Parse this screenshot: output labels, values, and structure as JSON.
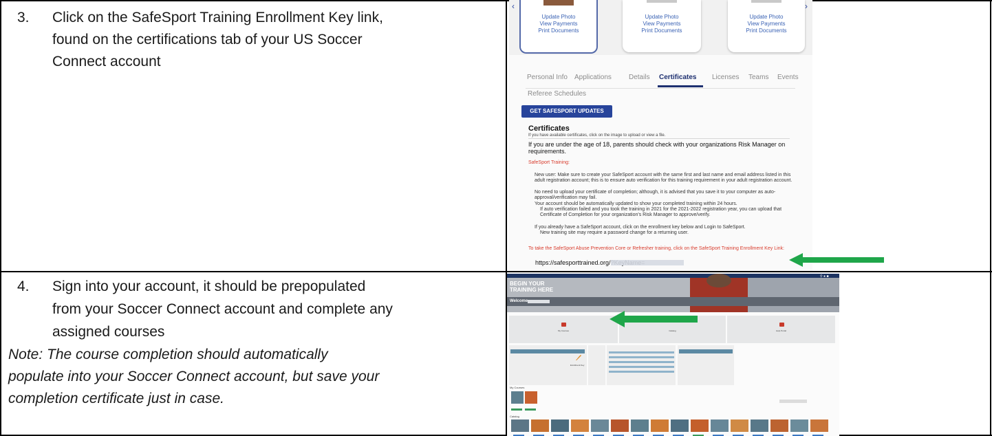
{
  "step3": {
    "number": "3.",
    "lines": [
      "Click on the SafeSport Training Enrollment Key link,",
      "found on the certifications tab of your US Soccer",
      "Connect account"
    ]
  },
  "step4": {
    "number": "4.",
    "lines": [
      "Sign into your account, it should be prepopulated",
      "from your Soccer Connect account and complete any",
      "assigned courses"
    ],
    "note_lines": [
      "Note: The course completion should automatically",
      "populate into your Soccer Connect account, but save your",
      "completion certificate just in case."
    ]
  },
  "shot1": {
    "cards": [
      {
        "line1": "Update Photo",
        "line2": "View Payments",
        "line3": "Print Documents"
      },
      {
        "line1": "Update Photo",
        "line2": "View Payments",
        "line3": "Print Documents"
      },
      {
        "line1": "Update Photo",
        "line2": "View Payments",
        "line3": "Print Documents"
      }
    ],
    "tabs": [
      "Personal Info",
      "Applications",
      "Details",
      "Certificates",
      "Licenses",
      "Teams",
      "Events"
    ],
    "active_tab": "Certificates",
    "tab_row2": "Referee Schedules",
    "button": "GET SAFESPORT UPDATES",
    "cert_title": "Certificates",
    "cert_subtitle": "If you have available certificates, click on the image to upload or view a file.",
    "age_notice": "If you are under the age of 18, parents should check with your organizations Risk Manager on requirements.",
    "safesport_heading": "SafeSport Training:",
    "paragraphs": [
      "New user:  Make sure to create your SafeSport account with the same first and last name and email address listed in this adult registration account; this is to ensure auto verification for this training requirement in your adult registration account.",
      "No need to upload your certificate of completion; although, it is advised that you save it to your computer as auto-approval/verification may fail.",
      "Your account should be automatically updated to show your completed training within 24 hours.",
      "If auto verification failed and you took the training in 2021 for the 2021-2022 registration year, you can upload that Certificate of Completion for your organization's Risk Manager to approve/verify.",
      "If you already have a SafeSport account, click on the enrollment key below and Login to SafeSport.",
      "New training site may require a password change for a returning user."
    ],
    "enroll_instruction": "To take the SafeSport Abuse Prevention Core or Refresher training, click on the SafeSport Training Enrollment Key Link:",
    "enroll_link": "https://safesporttrained.org/?KeyName="
  },
  "shot2": {
    "hero_title_line1": "BEGIN YOUR",
    "hero_title_line2": "TRAINING HERE",
    "welcome": "Welcome,",
    "tiles": [
      {
        "label": "My Courses"
      },
      {
        "label": "Catalog"
      },
      {
        "label": "Help Portal"
      }
    ],
    "enrollment_key": "Enrollment Key",
    "my_courses": "My Courses",
    "catalog": "Catalog"
  },
  "colors": {
    "arrow": "#1fa64a",
    "tab_active": "#1e3070",
    "button_bg": "#27449b",
    "red_text": "#d83b2c",
    "link_blue": "#3a62b4"
  }
}
